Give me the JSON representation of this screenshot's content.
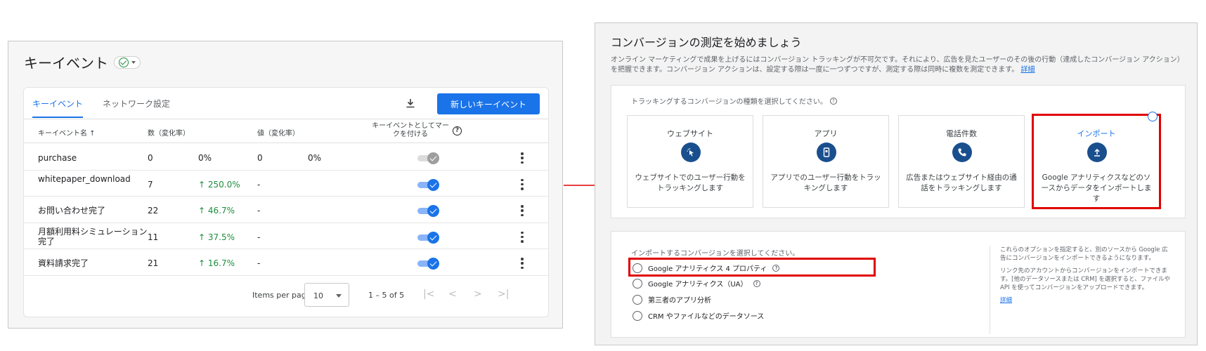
{
  "left": {
    "title": "キーイベント",
    "tabs": [
      "キーイベント",
      "ネットワーク設定"
    ],
    "new_button": "新しいキーイベント",
    "columns": {
      "name": "キーイベント名 ↑",
      "count": "数（変化率）",
      "value": "値（変化率）",
      "mark": "キーイベントとしてマークを付ける",
      "help": "?"
    },
    "rows": [
      {
        "name": "purchase",
        "count": "0",
        "change": "0%",
        "value": "0",
        "value_change": "0%",
        "toggle": false
      },
      {
        "name": "whitepaper_download",
        "count": "7",
        "change": "↑ 250.0%",
        "value": "-",
        "value_change": "",
        "toggle": true
      },
      {
        "name": "お問い合わせ完了",
        "count": "22",
        "change": "↑ 46.7%",
        "value": "-",
        "value_change": "",
        "toggle": true
      },
      {
        "name": "月額利用料シミュレーション完了",
        "count": "11",
        "change": "↑ 37.5%",
        "value": "-",
        "value_change": "",
        "toggle": true
      },
      {
        "name": "資料請求完了",
        "count": "21",
        "change": "↑ 16.7%",
        "value": "-",
        "value_change": "",
        "toggle": true
      }
    ],
    "pager": {
      "items_per_page_label": "Items per page:",
      "items_per_page": "10",
      "range": "1 – 5 of 5",
      "nav": [
        "|<",
        "<",
        ">",
        ">|"
      ]
    }
  },
  "right": {
    "title": "コンバージョンの測定を始めましょう",
    "description": "オンライン マーケティングで成果を上げるにはコンバージョン トラッキングが不可欠です。それにより、広告を見たユーザーのその後の行動（達成したコンバージョン アクション）を把握できます。コンバージョン アクションは、設定する際は一度に一つずつですが、測定する際は同時に複数を測定できます。",
    "description_link": "詳細",
    "type_label": "トラッキングするコンバージョンの種類を選択してください。",
    "types": [
      {
        "title": "ウェブサイト",
        "icon": "cursor-click-icon",
        "desc": "ウェブサイトでのユーザー行動をトラッキングします"
      },
      {
        "title": "アプリ",
        "icon": "phone-app-icon",
        "desc": "アプリでのユーザー行動をトラッキングします"
      },
      {
        "title": "電話件数",
        "icon": "phone-call-icon",
        "desc": "広告またはウェブサイト経由の通話をトラッキングします"
      },
      {
        "title": "インポート",
        "icon": "upload-icon",
        "desc": "Google アナリティクスなどのソースからデータをインポートします"
      }
    ],
    "import_label": "インポートするコンバージョンを選択してください。",
    "import_options": [
      "Google アナリティクス 4 プロパティ",
      "Google アナリティクス（UA）",
      "第三者のアプリ分析",
      "CRM やファイルなどのデータソース"
    ],
    "side_info_1": "これらのオプションを指定すると、別のソースから Google 広告にコンバージョンをインポートできるようになります。",
    "side_info_2": "リンク先のアカウントからコンバージョンをインポートできます。[他のデータソースまたは CRM] を選択すると、ファイルや API を使ってコンバージョンをアップロードできます。",
    "side_link": "詳細"
  },
  "colors": {
    "accent": "#1a73e8",
    "highlight": "#e00000",
    "positive": "#1e8e3e"
  }
}
